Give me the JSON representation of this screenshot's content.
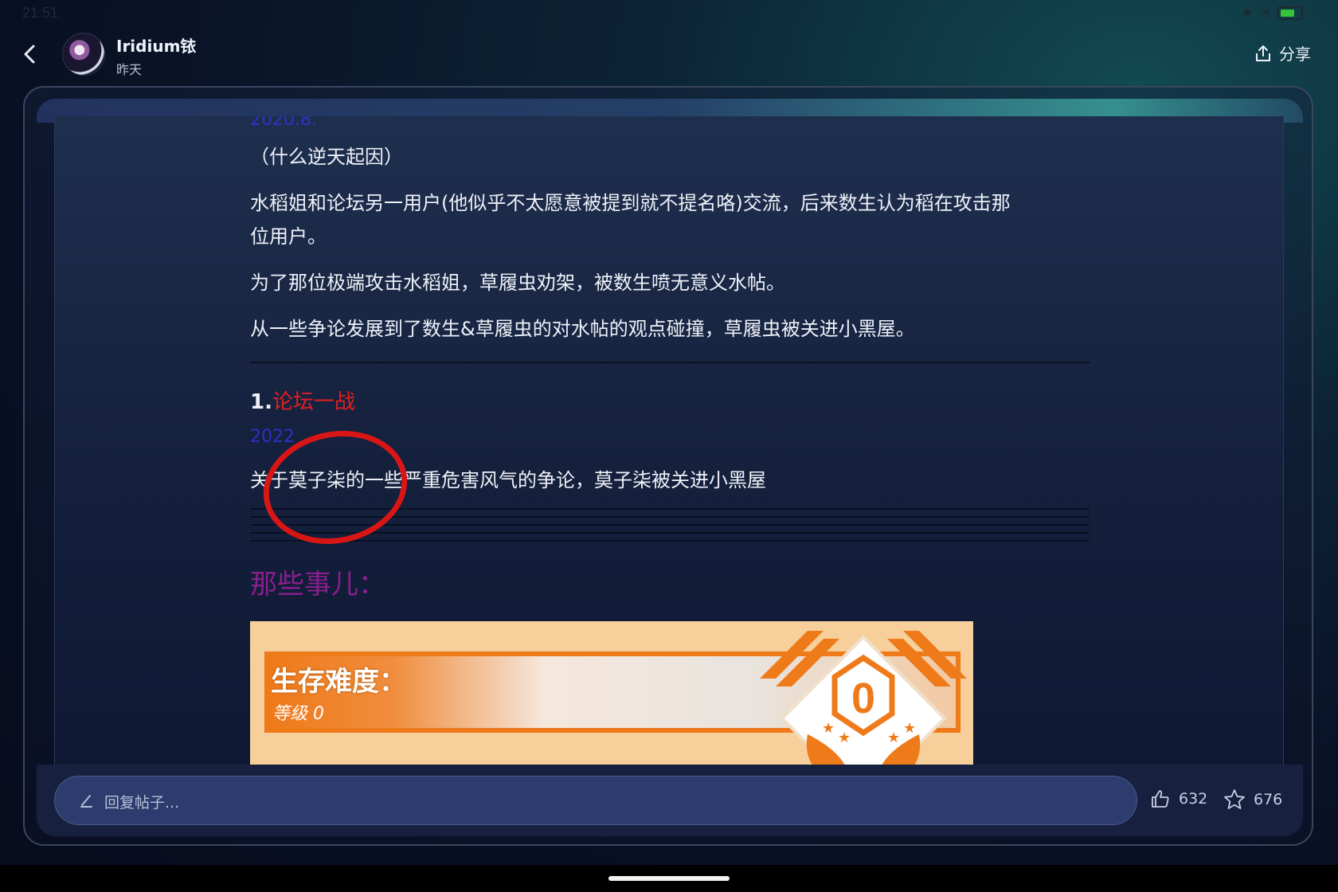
{
  "status_bar": {
    "time": "21:51"
  },
  "header": {
    "author": "Iridium铱",
    "time": "昨天",
    "share_label": "分享"
  },
  "post": {
    "cut_date": "2020.8.",
    "paragraphs": [
      "（什么逆天起因）",
      "水稻姐和论坛另一用户(他似乎不太愿意被提到就不提名咯)交流，后来数生认为稻在攻击那",
      "位用户。",
      "为了那位极端攻击水稻姐，草履虫劝架，被数生喷无意义水帖。",
      "从一些争论发展到了数生&草履虫的对水帖的观点碰撞，草履虫被关进小黑屋。"
    ],
    "section": {
      "number": "1.",
      "title": "论坛一战",
      "date": "2022",
      "text": "关于莫子柒的一些严重危害风气的争论，莫子柒被关进小黑屋"
    },
    "purple_heading": "那些事儿：",
    "banner": {
      "title": "生存难度：",
      "subtitle": "等级 0",
      "badge_value": "0"
    }
  },
  "bottom_bar": {
    "reply_placeholder": "回复帖子...",
    "likes": "632",
    "favorites": "676"
  },
  "colors": {
    "red_title": "#e11f1f",
    "blue_date": "#2e2fc7",
    "purple_heading": "#8a1e8e",
    "banner_orange": "#ef7a1a",
    "annotation_circle": "#d81616"
  }
}
